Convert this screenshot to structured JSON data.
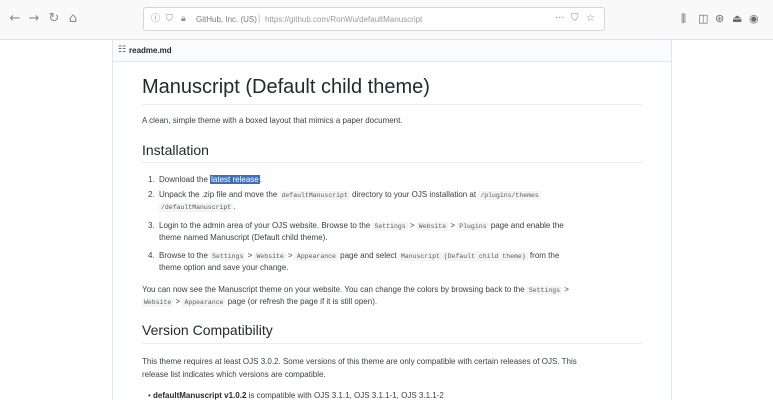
{
  "browser": {
    "url_identity": "GitHub, Inc. (US)",
    "url": "https://github.com/RonWu/defaultManuscript",
    "more_glyph": "···"
  },
  "readme": {
    "filename": "readme.md",
    "title": "Manuscript (Default child theme)",
    "description": "A clean, simple theme with a boxed layout that mimics a paper document.",
    "installation": {
      "heading": "Installation",
      "steps": [
        {
          "num": "1.",
          "pre": "Download the ",
          "link": "latest release",
          "post": "."
        },
        {
          "num": "2.",
          "a": "Unpack the .zip file and move the ",
          "code1": "defaultManuscript",
          "b": " directory to your OJS installation at ",
          "code2": "/plugins/themes",
          "c_code": "/defaultManuscript",
          "c": "."
        },
        {
          "num": "3.",
          "a": "Login to the admin area of your OJS website. Browse to the ",
          "code1": "Settings",
          "s1": " > ",
          "code2": "Website",
          "s2": " > ",
          "code3": "Plugins",
          "b": " page and enable the",
          "c": "theme named Manuscript (Default child theme)."
        },
        {
          "num": "4.",
          "a": "Browse to the ",
          "code1": "Settings",
          "s1": " > ",
          "code2": "Website",
          "s2": " > ",
          "code3": "Appearance",
          "b": " page and select ",
          "code4": "Manuscript (Default child theme)",
          "b2": " from the",
          "c": "theme option and save your change."
        }
      ],
      "after": {
        "a": "You can now see the Manuscript theme on your website. You can change the colors by browsing back to the ",
        "code1": "Settings",
        "s1": " > ",
        "code2": "Website",
        "s2": " > ",
        "code3": "Appearance",
        "b": " page (or refresh the page if it is still open)."
      }
    },
    "compat": {
      "heading": "Version Compatibility",
      "line1": "This theme requires at least OJS 3.0.2. Some versions of this theme are only compatible with certain releases of OJS. This",
      "line2": "release list indicates which versions are compatible.",
      "bullet_bold": "defaultManuscript v1.0.2",
      "bullet_rest": " is compatible with OJS 3.1.1, OJS 3.1.1-1, OJS 3.1.1-2"
    }
  }
}
